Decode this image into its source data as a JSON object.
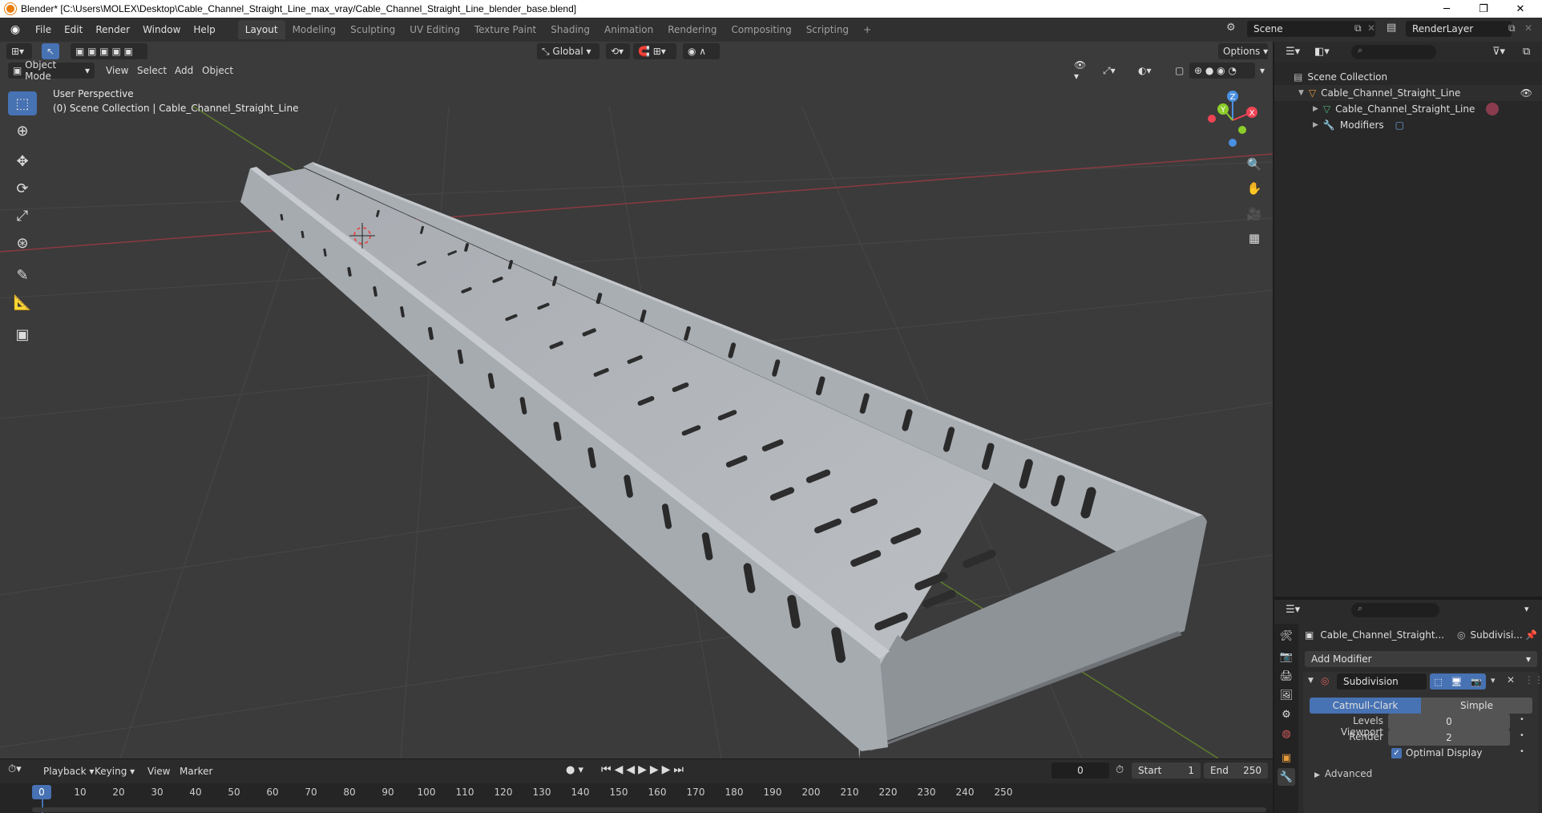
{
  "window": {
    "title": "Blender* [C:\\Users\\MOLEX\\Desktop\\Cable_Channel_Straight_Line_max_vray/Cable_Channel_Straight_Line_blender_base.blend]",
    "minimize": "─",
    "restore": "❐",
    "close": "✕"
  },
  "menu": [
    "File",
    "Edit",
    "Render",
    "Window",
    "Help"
  ],
  "workspaces": [
    "Layout",
    "Modeling",
    "Sculpting",
    "UV Editing",
    "Texture Paint",
    "Shading",
    "Animation",
    "Rendering",
    "Compositing",
    "Scripting"
  ],
  "workspace_add": "+",
  "scene": {
    "name": "Scene",
    "render_layer": "RenderLayer"
  },
  "viewport": {
    "mode": "Object Mode",
    "menus": [
      "View",
      "Select",
      "Add",
      "Object"
    ],
    "transform_orientation": "Global",
    "options": "Options",
    "info_line1": "User Perspective",
    "info_line2": "(0) Scene Collection | Cable_Channel_Straight_Line",
    "gizmo": {
      "z": "Z",
      "y": "Y",
      "x": "X"
    }
  },
  "toolbar": [
    "select-box",
    "cursor",
    "move",
    "rotate",
    "scale",
    "transform",
    "annotate",
    "measure",
    "add-cube"
  ],
  "timeline": {
    "menus": [
      "Playback",
      "Keying",
      "View",
      "Marker"
    ],
    "current_frame": "0",
    "start_label": "Start",
    "start": "1",
    "end_label": "End",
    "end": "250",
    "frames": [
      "0",
      "10",
      "20",
      "30",
      "40",
      "50",
      "60",
      "70",
      "80",
      "90",
      "100",
      "110",
      "120",
      "130",
      "140",
      "150",
      "160",
      "170",
      "180",
      "190",
      "200",
      "210",
      "220",
      "230",
      "240",
      "250"
    ]
  },
  "outliner": {
    "root": "Scene Collection",
    "items": [
      {
        "label": "Cable_Channel_Straight_Line"
      },
      {
        "label": "Cable_Channel_Straight_Line"
      },
      {
        "label": "Modifiers"
      }
    ]
  },
  "properties": {
    "object_name": "Cable_Channel_Straight...",
    "modifier_tab": "Subdivisi...",
    "add_modifier": "Add Modifier",
    "modifier_name": "Subdivision",
    "catmull": "Catmull-Clark",
    "simple": "Simple",
    "levels_viewport_label": "Levels Viewport",
    "levels_viewport": "0",
    "render_label": "Render",
    "render": "2",
    "optimal_display": "Optimal Display",
    "advanced": "Advanced"
  },
  "colors": {
    "accent": "#4772b3",
    "axis_x": "#ee4455",
    "axis_y": "#8ccd2a",
    "axis_z": "#4a90e2",
    "mesh": "#b4b8bd",
    "viewport_bg": "#3b3b3b"
  }
}
